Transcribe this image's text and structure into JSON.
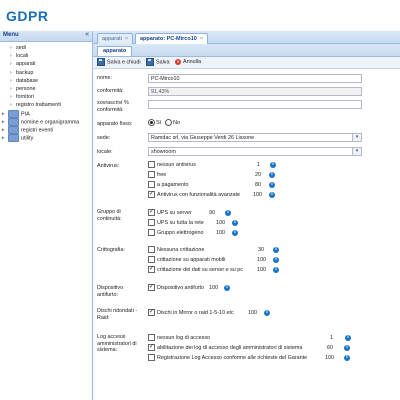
{
  "app": {
    "title": "GDPR"
  },
  "menu": {
    "title": "Menu",
    "collapse_glyph": "«",
    "children": [
      "sedi",
      "locali",
      "apparati",
      "backup",
      "database",
      "persone",
      "fornitori",
      "registro trattamenti"
    ],
    "folders": [
      "PIA",
      "nomine e organigramma",
      "registri eventi",
      "utility"
    ]
  },
  "tabs": [
    {
      "label": "apparati",
      "active": false
    },
    {
      "label": "apparato: PC-Mirco10",
      "active": true
    }
  ],
  "subtab": "apparato",
  "toolbar": {
    "save_close": "Salva e chiudi",
    "save": "Salva",
    "cancel": "Annulla"
  },
  "form": {
    "nome": {
      "label": "nome:",
      "value": "PC-Mirco10"
    },
    "conformita": {
      "label": "conformità:",
      "value": "91,43%"
    },
    "sovrascrivi": {
      "label": "sovrascrivi % conformità:",
      "value": ""
    },
    "apparato_fisso": {
      "label": "apparato fisso:",
      "yes": "Sì",
      "no": "No",
      "selected": "Sì"
    },
    "sede": {
      "label": "sede:",
      "value": "Ramdac srl, via Giuseppe Verdi 26 Lissone"
    },
    "locale": {
      "label": "locale:",
      "value": "showroom"
    },
    "antivirus": {
      "label": "Antivirus:",
      "items": [
        {
          "text": "nessun antivirus",
          "value": "1",
          "checked": false
        },
        {
          "text": "free",
          "value": "20",
          "checked": false
        },
        {
          "text": "a pagamento",
          "value": "80",
          "checked": false
        },
        {
          "text": "Antivirus con funzionalità avanzate",
          "value": "100",
          "checked": true
        }
      ]
    },
    "gruppo": {
      "label": "Gruppo di continuità:",
      "items": [
        {
          "text": "UPS su server",
          "value": "90",
          "checked": true
        },
        {
          "text": "UPS su tutta la rete",
          "value": "100",
          "checked": false
        },
        {
          "text": "Gruppo elettrogeno",
          "value": "100",
          "checked": false
        }
      ]
    },
    "crittografia": {
      "label": "Crittografia:",
      "items": [
        {
          "text": "Nessuna crittazione",
          "value": "30",
          "checked": false
        },
        {
          "text": "crittazione su apparati mobili",
          "value": "100",
          "checked": false
        },
        {
          "text": "crittazione dei dati su server e su pc",
          "value": "100",
          "checked": true
        }
      ]
    },
    "antifurto": {
      "label": "Dispositivo antifurto:",
      "items": [
        {
          "text": "Dispositivo antifurto",
          "value": "100",
          "checked": true
        }
      ]
    },
    "dischi": {
      "label": "Dischi ridondati - Raid:",
      "items": [
        {
          "text": "Dischi in Mirror o raid 1-5-10 etc",
          "value": "100",
          "checked": true
        }
      ]
    },
    "log": {
      "label": "Log accessi amministratori di sistema:",
      "items": [
        {
          "text": "nessun log di accesso",
          "value": "1",
          "checked": false
        },
        {
          "text": "abilitazione dei log di accesso degli amministratori di sistema",
          "value": "60",
          "checked": true
        },
        {
          "text": "Registrazione Log Accesso conforme alle richieste del Garante",
          "value": "100",
          "checked": false
        }
      ]
    }
  },
  "colors": {
    "accent": "#1a6fb5",
    "panel_header": "#dae7f6",
    "info_icon": "#1a73c7"
  }
}
